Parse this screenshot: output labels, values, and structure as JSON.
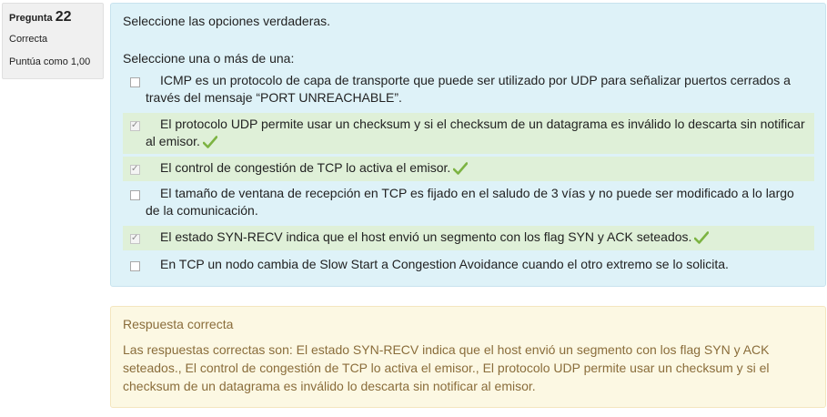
{
  "info": {
    "question_label": "Pregunta",
    "question_number": "22",
    "state": "Correcta",
    "grade": "Puntúa como 1,00"
  },
  "question": {
    "text": "Seleccione las opciones verdaderas.",
    "prompt": "Seleccione una o más de una:",
    "options": [
      {
        "text": "ICMP es un protocolo de capa de transporte que puede ser utilizado por UDP para señalizar puertos cerrados a través del mensaje “PORT UNREACHABLE”.",
        "checked": false,
        "correct": false
      },
      {
        "text": "El protocolo UDP permite usar un checksum y si el checksum de un datagrama es inválido lo descarta sin notificar al emisor.",
        "checked": true,
        "correct": true
      },
      {
        "text": "El control de congestión de TCP lo activa el emisor.",
        "checked": true,
        "correct": true
      },
      {
        "text": "El tamaño de ventana de recepción en TCP es fijado en el saludo de 3 vías y no puede ser modificado a lo largo de la comunicación.",
        "checked": false,
        "correct": false
      },
      {
        "text": "El estado SYN-RECV indica que el host envió un segmento con los flag SYN y ACK seteados.",
        "checked": true,
        "correct": true
      },
      {
        "text": "En TCP un nodo cambia de Slow Start a Congestion Avoidance cuando el otro extremo se lo solicita.",
        "checked": false,
        "correct": false
      }
    ]
  },
  "feedback": {
    "title": "Respuesta correcta",
    "body": "Las respuestas correctas son: El estado SYN-RECV indica que el host envió un segmento con los flag SYN y ACK seteados., El control de congestión de TCP lo activa el emisor., El protocolo UDP permite usar un checksum y si el checksum de un datagrama es inválido lo descarta sin notificar al emisor."
  },
  "colors": {
    "check_green": "#7cb342",
    "correct_bg": "#dff0d8",
    "question_bg": "#def2f8",
    "feedback_bg": "#fcf8e3",
    "feedback_text": "#8a6d3b"
  },
  "icons": {
    "correct_mark": "check-icon"
  }
}
